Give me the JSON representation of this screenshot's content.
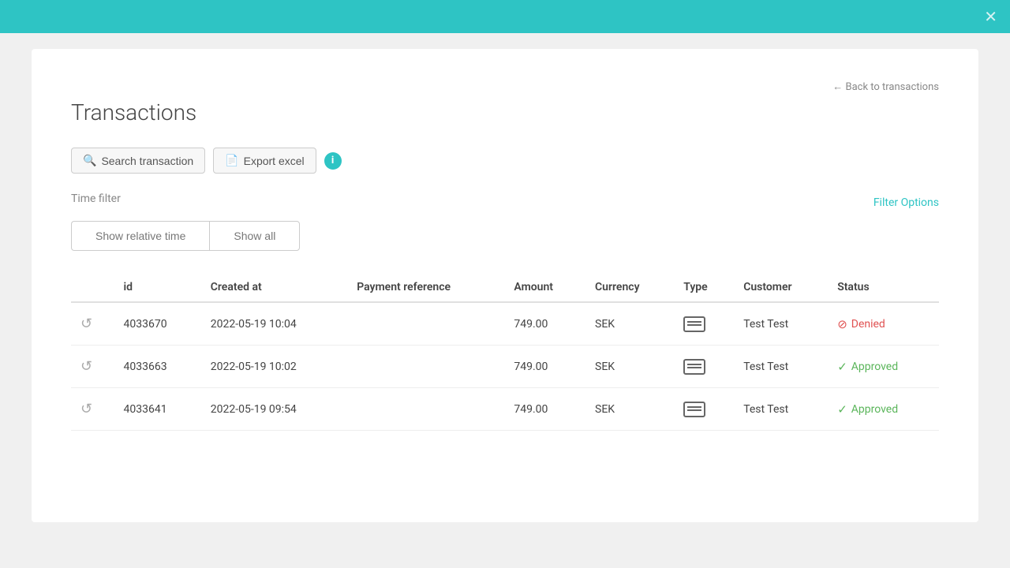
{
  "topbar": {
    "close_icon": "✕"
  },
  "header": {
    "title": "Transactions",
    "back_link": "← Back to transactions"
  },
  "toolbar": {
    "search_label": "Search transaction",
    "export_label": "Export excel",
    "info_icon": "i"
  },
  "time_filter": {
    "label": "Time filter",
    "show_relative_label": "Show relative time",
    "show_all_label": "Show all",
    "filter_options_label": "Filter Options"
  },
  "table": {
    "columns": [
      "",
      "id",
      "Created at",
      "Payment reference",
      "Amount",
      "Currency",
      "Type",
      "Customer",
      "Status"
    ],
    "rows": [
      {
        "icon": "↺",
        "id": "4033670",
        "created_at": "2022-05-19 10:04",
        "payment_reference": "",
        "amount": "749.00",
        "currency": "SEK",
        "type": "card",
        "customer": "Test Test",
        "status": "Denied",
        "status_type": "denied"
      },
      {
        "icon": "↺",
        "id": "4033663",
        "created_at": "2022-05-19 10:02",
        "payment_reference": "",
        "amount": "749.00",
        "currency": "SEK",
        "type": "card",
        "customer": "Test Test",
        "status": "Approved",
        "status_type": "approved"
      },
      {
        "icon": "↺",
        "id": "4033641",
        "created_at": "2022-05-19 09:54",
        "payment_reference": "",
        "amount": "749.00",
        "currency": "SEK",
        "type": "card",
        "customer": "Test Test",
        "status": "Approved",
        "status_type": "approved"
      }
    ]
  }
}
